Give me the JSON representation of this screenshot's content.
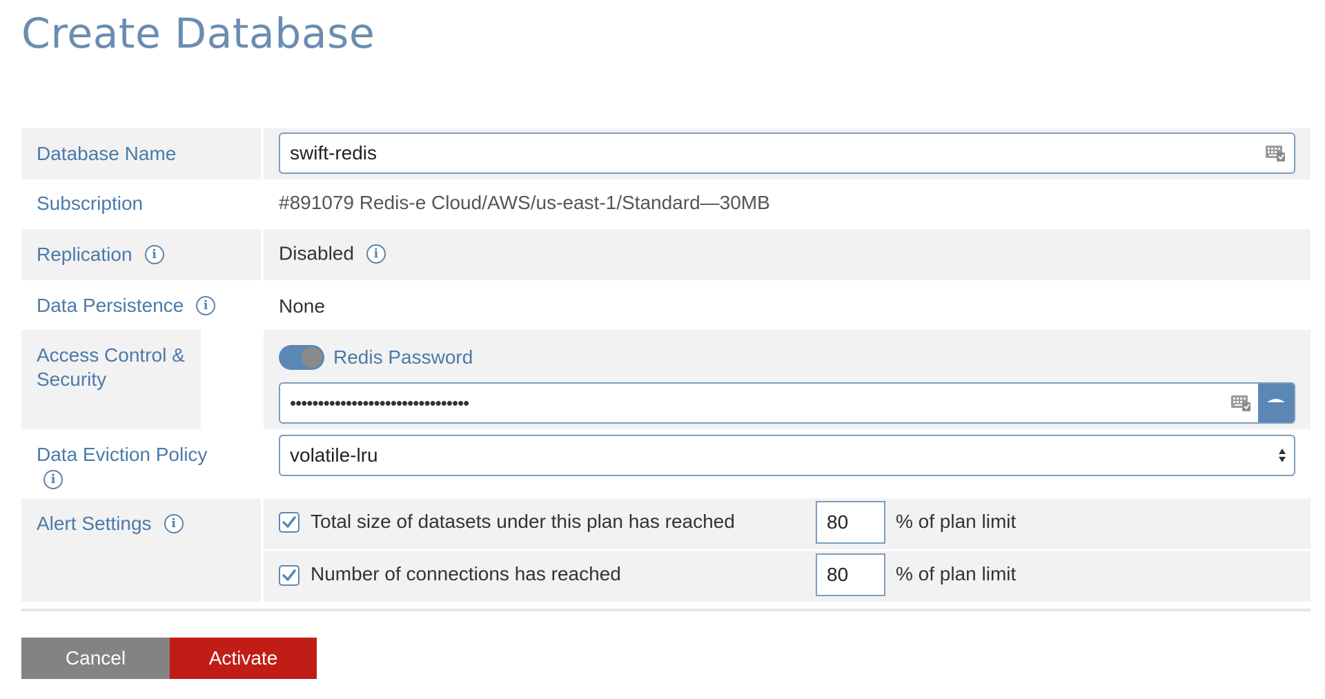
{
  "page": {
    "title": "Create Database"
  },
  "form": {
    "database_name": {
      "label": "Database Name",
      "value": "swift-redis"
    },
    "subscription": {
      "label": "Subscription",
      "value": "#891079 Redis-e Cloud/AWS/us-east-1/Standard—30MB"
    },
    "replication": {
      "label": "Replication",
      "value": "Disabled"
    },
    "persistence": {
      "label": "Data Persistence",
      "value": "None"
    },
    "access": {
      "label": "Access Control & Security",
      "toggle_label": "Redis Password",
      "toggle_on": true,
      "password_mask": "••••••••••••••••••••••••••••••••"
    },
    "eviction": {
      "label": "Data Eviction Policy",
      "value": "volatile-lru"
    },
    "alerts": {
      "label": "Alert Settings",
      "items": [
        {
          "text": "Total size of datasets under this plan has reached",
          "checked": true,
          "value": "80",
          "suffix": "% of plan limit"
        },
        {
          "text": "Number of connections has reached",
          "checked": true,
          "value": "80",
          "suffix": "% of plan limit"
        }
      ]
    }
  },
  "actions": {
    "cancel_label": "Cancel",
    "activate_label": "Activate"
  },
  "colors": {
    "label": "#4a7aa8",
    "title": "#6a8db0",
    "accent": "#5b87b5",
    "activate": "#c01d17",
    "cancel": "#838383"
  },
  "icons": {
    "info": "info-icon",
    "keyboard": "keyboard-icon",
    "eye": "eye-icon",
    "check": "checkmark-icon",
    "sort": "select-arrows-icon"
  }
}
